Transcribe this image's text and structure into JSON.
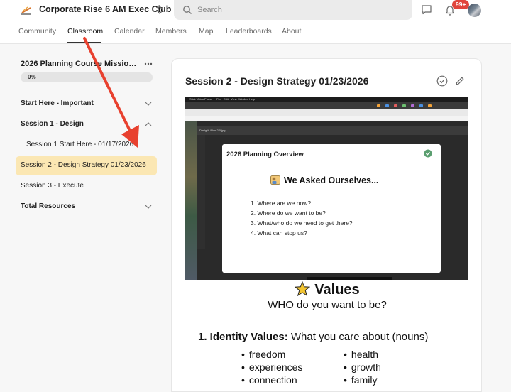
{
  "header": {
    "club_name": "Corporate Rise 6 AM Exec Club",
    "search_placeholder": "Search",
    "notification_count": "99+",
    "icons": [
      "club-logo-icon",
      "switch-icon",
      "search-icon",
      "chat-icon",
      "bell-icon"
    ]
  },
  "nav": {
    "tabs": [
      {
        "label": "Community"
      },
      {
        "label": "Classroom"
      },
      {
        "label": "Calendar"
      },
      {
        "label": "Members"
      },
      {
        "label": "Map"
      },
      {
        "label": "Leaderboards"
      },
      {
        "label": "About"
      }
    ],
    "active": "Classroom"
  },
  "sidebar": {
    "course_title": "2026 Planning Course Mission V...",
    "progress_label": "0%",
    "progress_value": 0,
    "items": [
      {
        "label": "Start Here - Important",
        "type": "section",
        "expanded": false
      },
      {
        "label": "Session 1 - Design",
        "type": "section",
        "expanded": true
      },
      {
        "label": "Session 1 Start Here - 01/17/2026",
        "type": "lesson"
      },
      {
        "label": "Session 2 - Design Strategy 01/23/2026",
        "type": "lesson",
        "active": true
      },
      {
        "label": "Session 3 - Execute",
        "type": "lesson"
      },
      {
        "label": "Total Resources",
        "type": "section",
        "expanded": false
      }
    ]
  },
  "lesson": {
    "title": "Session 2 - Design Strategy 01/23/2026",
    "video": {
      "slide_header": "2026 Planning Overview",
      "slide_heading": "We Asked Ourselves...",
      "questions": [
        "1. Where are we now?",
        "2. Where do we want to be?",
        "3. What/who do we need to get there?",
        "4. What can stop us?"
      ],
      "menubar": [
        "Stick Video Player",
        "File",
        "Edit",
        "View",
        "Window",
        "Help"
      ],
      "toolbar_text": "Desig N Plan 2.0.jpg"
    },
    "values": {
      "title": "Values",
      "subtitle": "WHO do you want to be?",
      "identity_bold": "1. Identity Values:",
      "identity_rest": " What you care about (nouns)",
      "col1": [
        "freedom",
        "experiences",
        "connection"
      ],
      "col2": [
        "health",
        "growth",
        "family"
      ]
    }
  },
  "colors": {
    "accent_highlight": "#fbe7b3",
    "annotation_arrow": "#e8412f",
    "badge": "#e0453d"
  }
}
